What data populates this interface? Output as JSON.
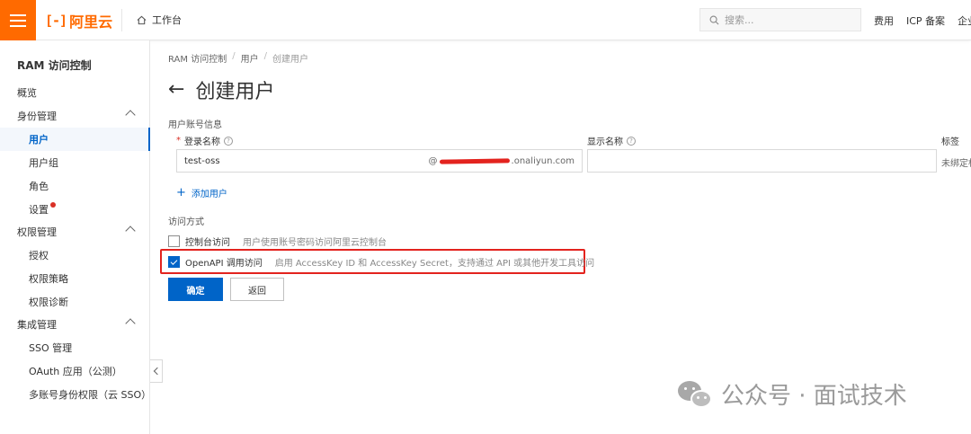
{
  "header": {
    "logo_text": "阿里云",
    "logo_mark": "[-]",
    "workbench": "工作台",
    "search_placeholder": "搜索...",
    "nav": [
      "费用",
      "ICP 备案",
      "企业"
    ]
  },
  "sidebar": {
    "title": "RAM 访问控制",
    "items": [
      {
        "label": "概览",
        "level": 0
      },
      {
        "label": "身份管理",
        "level": 0,
        "expandable": true
      },
      {
        "label": "用户",
        "level": 1,
        "active": true
      },
      {
        "label": "用户组",
        "level": 1
      },
      {
        "label": "角色",
        "level": 1
      },
      {
        "label": "设置",
        "level": 1,
        "badge": true
      },
      {
        "label": "权限管理",
        "level": 0,
        "expandable": true
      },
      {
        "label": "授权",
        "level": 1
      },
      {
        "label": "权限策略",
        "level": 1
      },
      {
        "label": "权限诊断",
        "level": 1
      },
      {
        "label": "集成管理",
        "level": 0,
        "expandable": true
      },
      {
        "label": "SSO 管理",
        "level": 1
      },
      {
        "label": "OAuth 应用（公测）",
        "level": 1
      },
      {
        "label": "多账号身份权限（云 SSO）",
        "level": 1
      }
    ]
  },
  "breadcrumb": [
    "RAM 访问控制",
    "用户",
    "创建用户"
  ],
  "page": {
    "title": "创建用户",
    "account_section": "用户账号信息",
    "login_name_label": "登录名称",
    "login_name_value": "test-oss",
    "login_domain_prefix": "@",
    "login_domain_suffix": ".onaliyun.com",
    "display_name_label": "显示名称",
    "display_name_value": "",
    "tag_label": "标签",
    "tag_hint": "未绑定标",
    "add_user": "添加用户",
    "access_section": "访问方式",
    "console_access_label": "控制台访问",
    "console_access_desc": "用户使用账号密码访问阿里云控制台",
    "console_access_checked": false,
    "openapi_access_label": "OpenAPI 调用访问",
    "openapi_access_desc": "启用 AccessKey ID 和 AccessKey Secret，支持通过 API 或其他开发工具访问",
    "openapi_access_checked": true,
    "confirm_button": "确定",
    "back_button": "返回"
  },
  "watermark": {
    "text": "公众号 · 面试技术"
  },
  "colors": {
    "brand": "#ff6a00",
    "primary": "#0064c8",
    "highlight": "#e3231e"
  }
}
